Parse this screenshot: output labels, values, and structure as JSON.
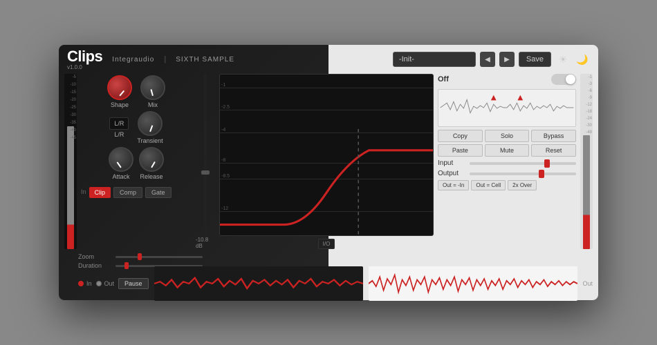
{
  "app": {
    "title": "Clips",
    "version": "v1.0.0",
    "brand1": "Integraudio",
    "separator": "|",
    "brand2": "SIXTH SAMPLE",
    "preset": "-Init-",
    "save_label": "Save",
    "theme_light": "☀",
    "theme_dark": "🌙"
  },
  "knobs": {
    "shape_label": "Shape",
    "mix_label": "Mix",
    "lr_label": "L/R",
    "transient_label": "Transient",
    "attack_label": "Attack",
    "release_label": "Release"
  },
  "db_value": "-10.8 dB",
  "mode_buttons": {
    "clip": "Clip",
    "comp": "Comp",
    "gate": "Gate",
    "active": "clip"
  },
  "in_label": "In",
  "graph": {
    "labels": [
      "-1",
      "-2.5",
      "-4",
      "-8",
      "-8.5",
      "-12"
    ]
  },
  "io_label": "I/O",
  "right_panel": {
    "off_label": "Off",
    "toggle_state": "off",
    "action_buttons": [
      "Copy",
      "Solo",
      "Bypass",
      "Paste",
      "Mute",
      "Reset"
    ],
    "input_label": "Input",
    "output_label": "Output",
    "routing_buttons": [
      "Out = -In",
      "Out = Cell",
      "2x Over"
    ]
  },
  "bottom": {
    "zoom_label": "Zoom",
    "duration_label": "Duration",
    "in_label": "In",
    "out_label": "Out",
    "pause_label": "Pause"
  },
  "out_label": "Out",
  "vu_labels_left": [
    "-5",
    "-10",
    "-15",
    "-20",
    "-25",
    "-30",
    "-35",
    "-40",
    "-45"
  ],
  "vu_labels_right": [
    "-1",
    "-3",
    "-6",
    "-9",
    "-12",
    "-18",
    "-24",
    "-30",
    "-40",
    "-48"
  ]
}
